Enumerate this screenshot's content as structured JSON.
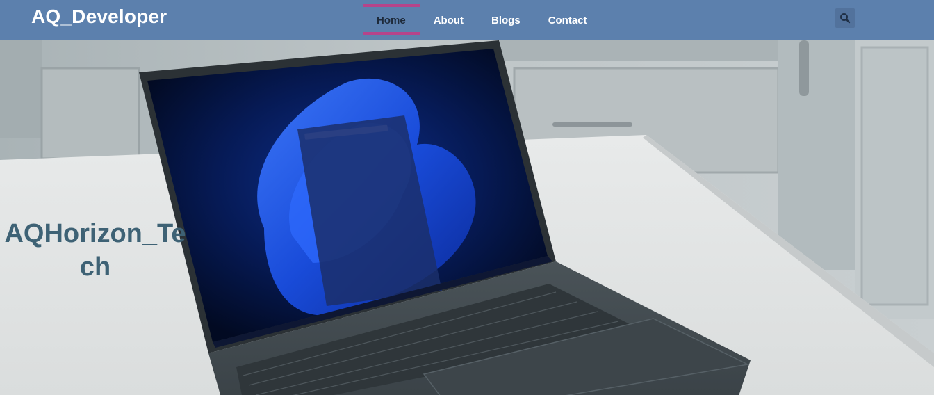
{
  "header": {
    "brand": "AQ_Developer",
    "nav": [
      {
        "label": "Home",
        "active": true
      },
      {
        "label": "About",
        "active": false
      },
      {
        "label": "Blogs",
        "active": false
      },
      {
        "label": "Contact",
        "active": false
      }
    ],
    "search_icon": "search-icon"
  },
  "hero": {
    "title": "AQHorizon_Tech",
    "image": "laptop-on-kitchen-counter-photo"
  },
  "colors": {
    "navbar": "#5c80ad",
    "active_underline": "#b5448a",
    "hero_title": "#3e6275"
  }
}
